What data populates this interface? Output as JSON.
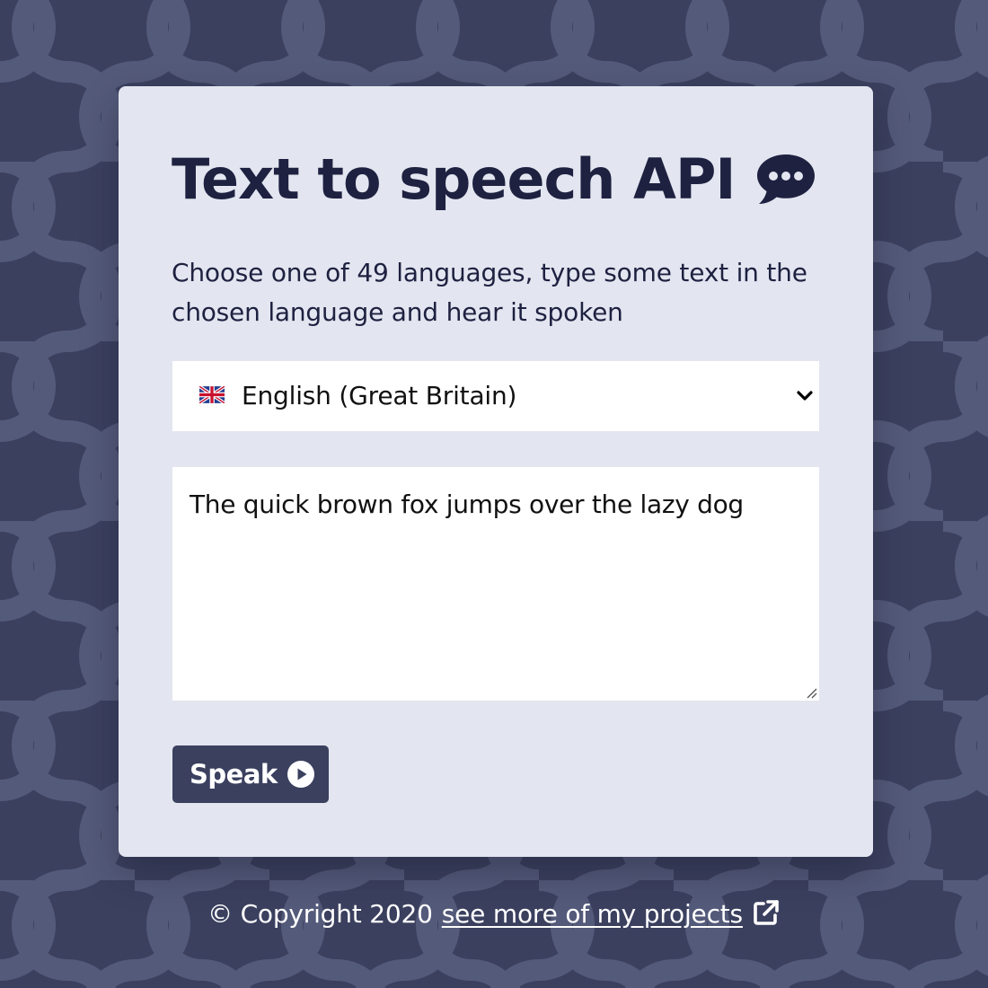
{
  "colors": {
    "background": "#3b405f",
    "pattern": "#545a7a",
    "card": "#e3e6f0",
    "heading": "#1e2140",
    "button": "#3b405f",
    "footer_text": "#ffffff"
  },
  "header": {
    "title": "Text to speech API",
    "title_icon": "speech-bubble-icon"
  },
  "intro": {
    "description": "Choose one of 49 languages, type some text in the chosen language and hear it spoken"
  },
  "language_select": {
    "selected_flag": "uk-flag-icon",
    "selected_label": "English (Great Britain)",
    "chevron_icon": "chevron-down-icon"
  },
  "text_input": {
    "value": "The quick brown fox jumps over the lazy dog"
  },
  "speak_button": {
    "label": "Speak",
    "icon": "play-circle-icon"
  },
  "footer": {
    "copyright": "© Copyright 2020",
    "link_label": "see more of my projects",
    "link_icon": "external-link-icon"
  }
}
